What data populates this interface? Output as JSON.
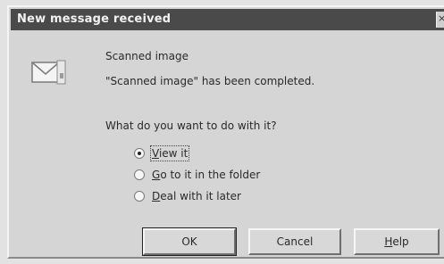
{
  "window": {
    "title": "New message received",
    "close_glyph": "×"
  },
  "icons": {
    "message": "envelope-icon"
  },
  "message": {
    "subject": "Scanned image",
    "body": "\"Scanned image\" has been completed."
  },
  "question": "What do you want to do with it?",
  "options": [
    {
      "hotkey": "V",
      "rest": "iew it",
      "selected": true
    },
    {
      "hotkey": "G",
      "rest": "o to it in the folder",
      "selected": false
    },
    {
      "hotkey": "D",
      "rest": "eal with it later",
      "selected": false
    }
  ],
  "buttons": {
    "ok": "OK",
    "cancel": "Cancel",
    "help_hotkey": "H",
    "help_rest": "elp"
  }
}
